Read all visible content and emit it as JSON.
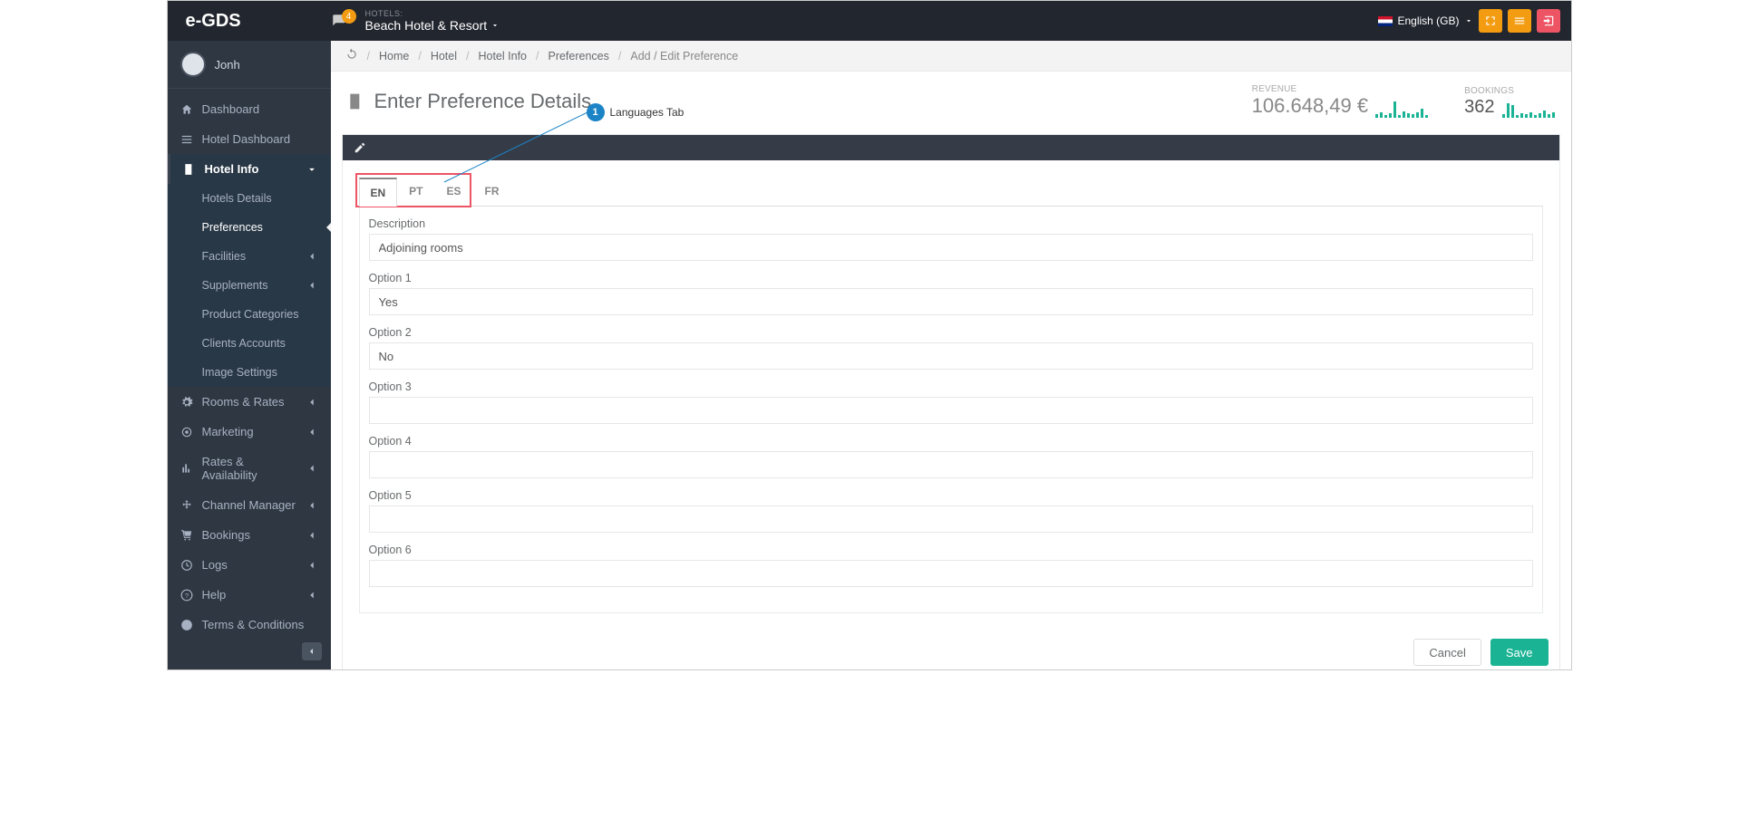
{
  "brand": "e-GDS",
  "notif_count": "4",
  "hotels_label": "HOTELS:",
  "hotel_name": "Beach Hotel & Resort",
  "language": "English (GB)",
  "user_name": "Jonh",
  "sidebar": {
    "dashboard": "Dashboard",
    "hotel_dashboard": "Hotel Dashboard",
    "hotel_info": "Hotel Info",
    "sub": {
      "hotels_details": "Hotels Details",
      "preferences": "Preferences",
      "facilities": "Facilities",
      "supplements": "Supplements",
      "product_categories": "Product Categories",
      "clients_accounts": "Clients Accounts",
      "image_settings": "Image Settings"
    },
    "rooms_rates": "Rooms & Rates",
    "marketing": "Marketing",
    "rates_avail": "Rates & Availability",
    "channel_manager": "Channel Manager",
    "bookings": "Bookings",
    "logs": "Logs",
    "help": "Help",
    "terms": "Terms & Conditions"
  },
  "breadcrumb": [
    "Home",
    "Hotel",
    "Hotel Info",
    "Preferences",
    "Add / Edit Preference"
  ],
  "page_title": "Enter Preference Details",
  "kpi": {
    "revenue_label": "REVENUE",
    "revenue_value": "106.648,49 €",
    "bookings_label": "BOOKINGS",
    "bookings_value": "362"
  },
  "lang_tabs": [
    "EN",
    "PT",
    "ES",
    "FR"
  ],
  "form": {
    "description_label": "Description",
    "description_value": "Adjoining rooms",
    "option1_label": "Option 1",
    "option1_value": "Yes",
    "option2_label": "Option 2",
    "option2_value": "No",
    "option3_label": "Option 3",
    "option3_value": "",
    "option4_label": "Option 4",
    "option4_value": "",
    "option5_label": "Option 5",
    "option5_value": "",
    "option6_label": "Option 6",
    "option6_value": ""
  },
  "buttons": {
    "cancel": "Cancel",
    "save": "Save"
  },
  "annotation": {
    "num": "1",
    "text": "Languages Tab"
  }
}
